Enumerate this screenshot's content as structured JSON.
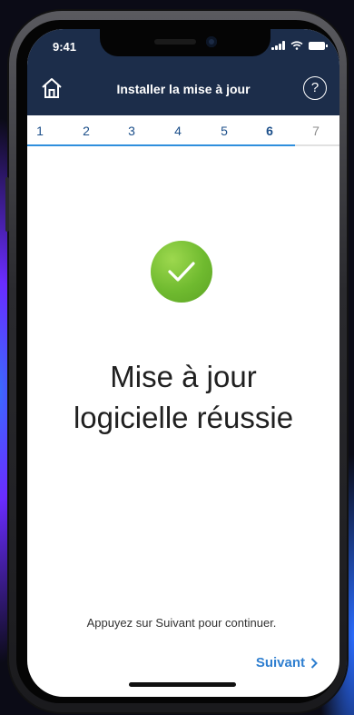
{
  "status_bar": {
    "time": "9:41"
  },
  "header": {
    "title": "Installer la mise à jour",
    "home_icon": "home-icon",
    "help_icon": "help-icon",
    "help_glyph": "?"
  },
  "stepper": {
    "steps": [
      "1",
      "2",
      "3",
      "4",
      "5",
      "6",
      "7"
    ],
    "current_step": 6,
    "progress": 0.857
  },
  "main": {
    "status_icon": "checkmark-icon",
    "headline_line1": "Mise à jour",
    "headline_line2": "logicielle réussie",
    "hint": "Appuyez sur Suivant pour continuer.",
    "next_label": "Suivant"
  },
  "colors": {
    "header_bg": "#1c2d4a",
    "accent": "#2f8fdd",
    "success": "#6fba2f"
  }
}
